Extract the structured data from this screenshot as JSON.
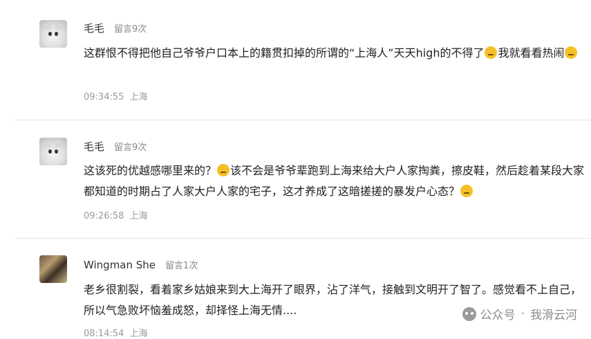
{
  "comments": [
    {
      "avatar": "cat-avatar",
      "name": "毛毛",
      "count": "留言9次",
      "text_before": "这群恨不得把他自己爷爷户口本上的籍贯扣掉的所谓的“上海人”天天high的不得了",
      "emoji_1": "thinking-emoji",
      "text_middle": "我就看看热闹",
      "emoji_2": "laughing-emoji",
      "time": "09:34:55",
      "location": "上海"
    },
    {
      "avatar": "cat-avatar",
      "name": "毛毛",
      "count": "留言9次",
      "text_before": "这该死的优越感哪里来的？",
      "emoji_1": "laughing-emoji",
      "text_middle": "该不会是爷爷辈跑到上海来给大户人家掏粪，擦皮鞋，然后趁着某段大家都知道的时期占了人家大户人家的宅子，这才养成了这暗搓搓的暴发户心态？",
      "emoji_2": "thinking-emoji",
      "time": "09:26:58",
      "location": "上海"
    },
    {
      "avatar": "photo-avatar",
      "name": "Wingman She",
      "count": "留言1次",
      "text_before": "老乡很割裂，看着家乡姑娘来到大上海开了眼界，沾了洋气，接触到文明开了智了。感觉看不上自己，所以气急败坏恼羞成怒，却择怪上海无情....",
      "time": "08:14:54",
      "location": "上海"
    }
  ],
  "watermark": {
    "prefix": "公众号",
    "separator": "·",
    "account": "我滑云河"
  }
}
